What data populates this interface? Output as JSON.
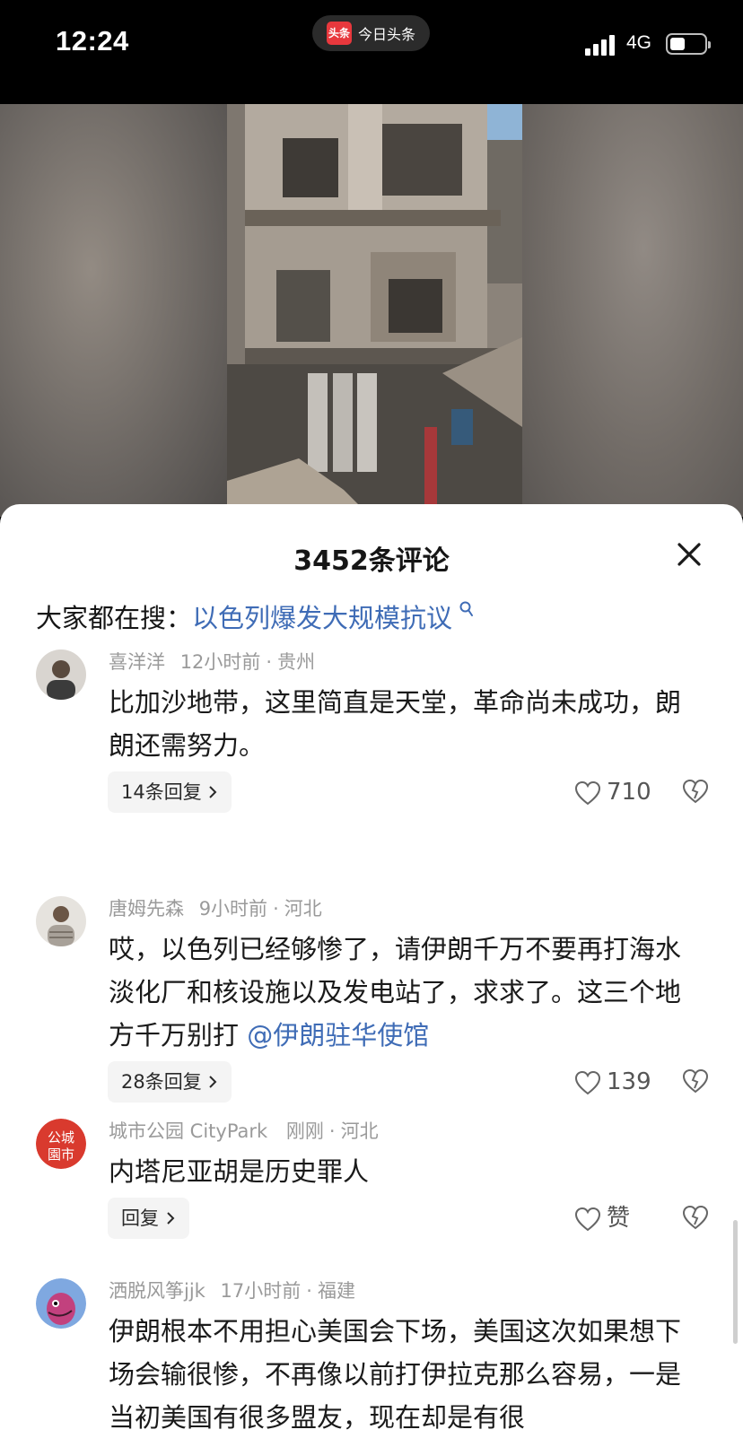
{
  "status_bar": {
    "time": "12:24",
    "app_logo": "头条",
    "app_name": "今日头条",
    "network": "4G"
  },
  "comments_sheet": {
    "title": "3452条评论",
    "hot_search_label": "大家都在搜：",
    "hot_search_term": "以色列爆发大规模抗议",
    "comments": [
      {
        "author": "喜洋洋",
        "time": "12小时前",
        "location": "贵州",
        "text": "比加沙地带，这里简直是天堂，革命尚未成功，朗朗还需努力。",
        "mention": "",
        "reply_label": "14条回复",
        "likes": "710"
      },
      {
        "author": "唐姆先森",
        "time": "9小时前",
        "location": "河北",
        "text": "哎，以色列已经够惨了，请伊朗千万不要再打海水淡化厂和核设施以及发电站了，求求了。这三个地方千万别打",
        "mention": "@伊朗驻华使馆",
        "reply_label": "28条回复",
        "likes": "139"
      },
      {
        "author": "城市公园 CityPark",
        "time": "刚刚",
        "location": "河北",
        "avatar_text": "公城園市",
        "text": "内塔尼亚胡是历史罪人",
        "mention": "",
        "reply_label": "回复",
        "likes": "赞"
      },
      {
        "author": "洒脱风筝jjk",
        "time": "17小时前",
        "location": "福建",
        "text": "伊朗根本不用担心美国会下场，美国这次如果想下场会输很惨，不再像以前打伊拉克那么容易，一是当初美国有很多盟友，现在却是有很",
        "mention": ""
      }
    ]
  },
  "colors": {
    "link_blue": "#3f6cb6",
    "meta_gray": "#9a9a9a",
    "brand_red": "#e8383d"
  },
  "icons": [
    "close-icon",
    "search-icon",
    "heart-icon",
    "dislike-heart-icon",
    "chevron-right-icon",
    "signal-icon",
    "battery-icon"
  ]
}
